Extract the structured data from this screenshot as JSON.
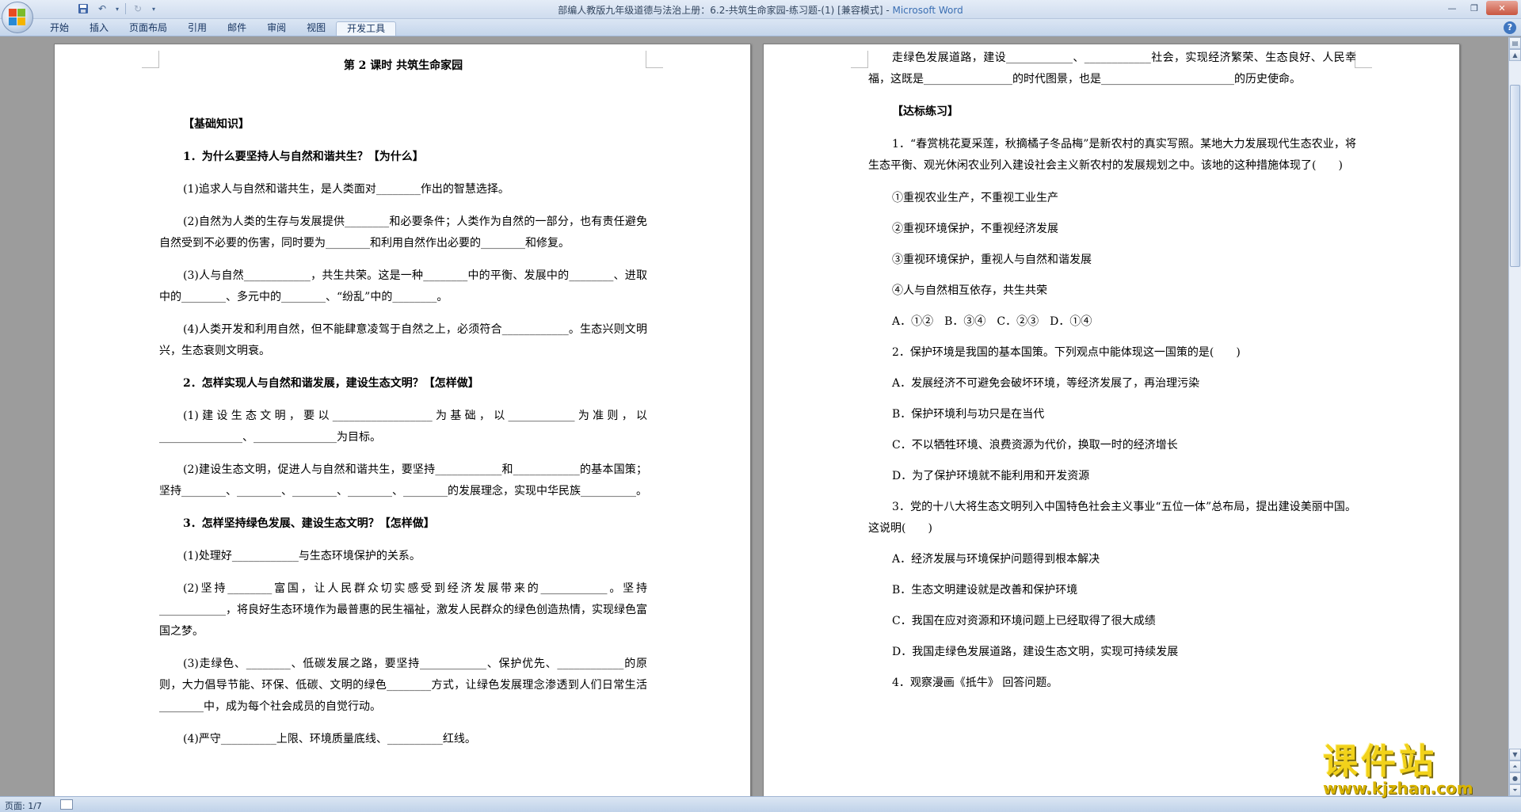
{
  "window": {
    "title_doc": "部编人教版九年级道德与法治上册：6.2-共筑生命家园-练习题-(1) [兼容模式] - ",
    "title_app": "Microsoft Word"
  },
  "ribbon": {
    "tabs": [
      "开始",
      "插入",
      "页面布局",
      "引用",
      "邮件",
      "审阅",
      "视图",
      "开发工具"
    ]
  },
  "status": {
    "page": "页面: 1/7"
  },
  "watermark": {
    "title": "课件站",
    "url": "www.kjzhan.com"
  },
  "left_page": {
    "title": "第 2 课时  共筑生命家园",
    "section1": "【基础知识】",
    "q1": "1．为什么要坚持人与自然和谐共生？【为什么】",
    "q1_1": "(1)追求人与自然和谐共生，是人类面对________作出的智慧选择。",
    "q1_2": "(2)自然为人类的生存与发展提供________和必要条件；人类作为自然的一部分，也有责任避免自然受到不必要的伤害，同时要为________和利用自然作出必要的________和修复。",
    "q1_3": "(3)人与自然____________，共生共荣。这是一种________中的平衡、发展中的________、进取中的________、多元中的________、“纷乱”中的________。",
    "q1_4": "(4)人类开发和利用自然，但不能肆意凌驾于自然之上，必须符合____________。生态兴则文明兴，生态衰则文明衰。",
    "q2": "2．怎样实现人与自然和谐发展，建设生态文明？【怎样做】",
    "q2_1": "(1)建设生态文明，要以__________________为基础，以____________为准则，以_______________、_______________为目标。",
    "q2_2": "(2)建设生态文明，促进人与自然和谐共生，要坚持____________和____________的基本国策；坚持________、________、________、________、________的发展理念，实现中华民族__________。",
    "q3": "3．怎样坚持绿色发展、建设生态文明？【怎样做】",
    "q3_1": "(1)处理好____________与生态环境保护的关系。",
    "q3_2": "(2)坚持________富国，让人民群众切实感受到经济发展带来的____________。坚持____________，将良好生态环境作为最普惠的民生福祉，激发人民群众的绿色创造热情，实现绿色富国之梦。",
    "q3_3": "(3)走绿色、________、低碳发展之路，要坚持____________、保护优先、____________的原则，大力倡导节能、环保、低碳、文明的绿色________方式，让绿色发展理念渗透到人们日常生活________中，成为每个社会成员的自觉行动。",
    "q3_4": "(4)严守__________上限、环境质量底线、__________红线。"
  },
  "right_page": {
    "p0": "走绿色发展道路，建设____________、____________社会，实现经济繁荣、生态良好、人民幸福，这既是________________的时代图景，也是________________________的历史使命。",
    "section2": "【达标练习】",
    "e1": "1．“春赏桃花夏采莲，秋摘橘子冬品梅”是新农村的真实写照。某地大力发展现代生态农业，将生态平衡、观光休闲农业列入建设社会主义新农村的发展规划之中。该地的这种措施体现了(　　)",
    "e1_o1": "①重视农业生产，不重视工业生产",
    "e1_o2": "②重视环境保护，不重视经济发展",
    "e1_o3": "③重视环境保护，重视人与自然和谐发展",
    "e1_o4": "④人与自然相互依存，共生共荣",
    "e1_ans": "A．①②　B．③④　C．②③　D．①④",
    "e2": "2．保护环境是我国的基本国策。下列观点中能体现这一国策的是(　　)",
    "e2_a": "A．发展经济不可避免会破坏环境，等经济发展了，再治理污染",
    "e2_b": "B．保护环境利与功只是在当代",
    "e2_c": "C．不以牺牲环境、浪费资源为代价，换取一时的经济增长",
    "e2_d": "D．为了保护环境就不能利用和开发资源",
    "e3": "3．党的十八大将生态文明列入中国特色社会主义事业“五位一体”总布局，提出建设美丽中国。这说明(　　)",
    "e3_a": "A．经济发展与环境保护问题得到根本解决",
    "e3_b": "B．生态文明建设就是改善和保护环境",
    "e3_c": "C．我国在应对资源和环境问题上已经取得了很大成绩",
    "e3_d": "D．我国走绿色发展道路，建设生态文明，实现可持续发展",
    "e4": "4．观察漫画《抵牛》 回答问题。"
  }
}
